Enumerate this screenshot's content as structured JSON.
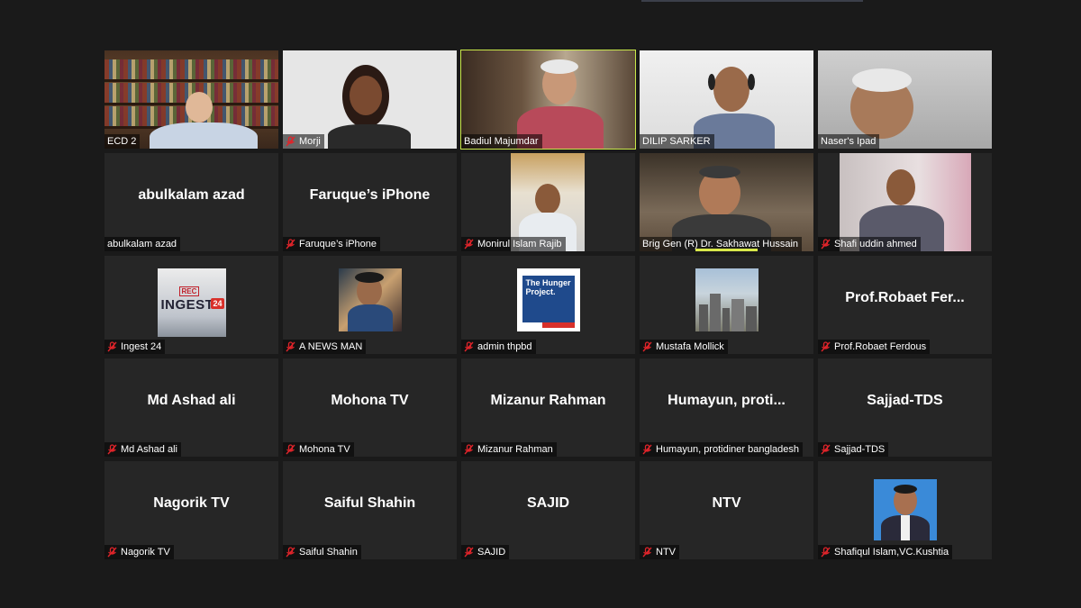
{
  "participants": [
    {
      "name": "ECD 2",
      "muted": false,
      "kind": "video"
    },
    {
      "name": "Morji",
      "muted": true,
      "kind": "video"
    },
    {
      "name": "Badiul Majumdar",
      "muted": false,
      "kind": "video",
      "active": true
    },
    {
      "name": "DILIP SARKER",
      "muted": false,
      "kind": "video"
    },
    {
      "name": "Naser's Ipad",
      "muted": false,
      "kind": "video"
    },
    {
      "name": "abulkalam azad",
      "display": "abulkalam azad",
      "muted": false,
      "kind": "name"
    },
    {
      "name": "Faruque's iPhone",
      "display": "Faruque’s iPhone",
      "muted": true,
      "kind": "name"
    },
    {
      "name": "Monirul Islam Rajib",
      "muted": true,
      "kind": "video"
    },
    {
      "name": "Brig Gen (R) Dr. Sakhawat Hussain",
      "muted": false,
      "kind": "video"
    },
    {
      "name": "Shafi uddin ahmed",
      "muted": true,
      "kind": "video"
    },
    {
      "name": "Ingest 24",
      "muted": true,
      "kind": "thumb",
      "thumb_text": "INGEST",
      "thumb_rec": "REC",
      "thumb_num": "24"
    },
    {
      "name": "A NEWS MAN",
      "muted": true,
      "kind": "thumb"
    },
    {
      "name": "admin thpbd",
      "muted": true,
      "kind": "thumb",
      "thumb_text": "The Hunger Project."
    },
    {
      "name": "Mustafa Mollick",
      "muted": true,
      "kind": "thumb"
    },
    {
      "name": "Prof.Robaet Ferdous",
      "display": "Prof.Robaet Fer...",
      "muted": true,
      "kind": "name"
    },
    {
      "name": "Md Ashad ali",
      "display": "Md Ashad ali",
      "muted": true,
      "kind": "name"
    },
    {
      "name": "Mohona TV",
      "display": "Mohona TV",
      "muted": true,
      "kind": "name"
    },
    {
      "name": "Mizanur Rahman",
      "display": "Mizanur Rahman",
      "muted": true,
      "kind": "name"
    },
    {
      "name": "Humayun, protidiner bangladesh",
      "display": "Humayun, proti...",
      "muted": true,
      "kind": "name"
    },
    {
      "name": "Sajjad-TDS",
      "display": "Sajjad-TDS",
      "muted": true,
      "kind": "name"
    },
    {
      "name": "Nagorik TV",
      "display": "Nagorik TV",
      "muted": true,
      "kind": "name"
    },
    {
      "name": "Saiful Shahin",
      "display": "Saiful Shahin",
      "muted": true,
      "kind": "name"
    },
    {
      "name": "SAJID",
      "display": "SAJID",
      "muted": true,
      "kind": "name"
    },
    {
      "name": "NTV",
      "display": "NTV",
      "muted": true,
      "kind": "name"
    },
    {
      "name": "Shafiqul Islam,VC.Kushtia",
      "muted": true,
      "kind": "thumb"
    }
  ],
  "colors": {
    "background": "#1a1a1a",
    "tile": "#262626",
    "active_border": "#c9e84a",
    "mute_icon": "#e0242a"
  },
  "icons": {
    "muted": "mic-muted-icon"
  }
}
